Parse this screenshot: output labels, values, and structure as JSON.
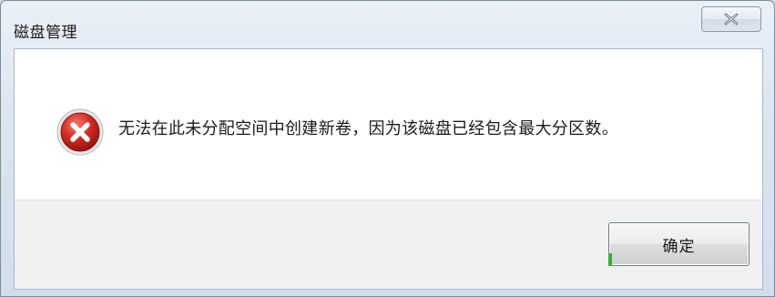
{
  "window": {
    "title": "磁盘管理",
    "close_icon": "close-icon"
  },
  "dialog": {
    "icon": "error-icon",
    "message": "无法在此未分配空间中创建新卷，因为该磁盘已经包含最大分区数。",
    "ok_label": "确定"
  },
  "colors": {
    "error_red": "#c62828",
    "titlebar": "#dbe5f1",
    "footer": "#f0f0f0"
  }
}
